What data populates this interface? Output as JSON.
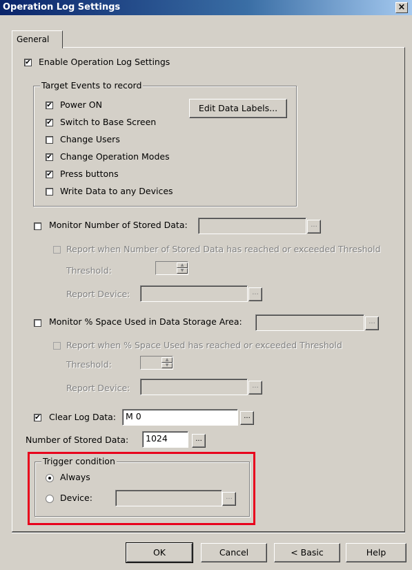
{
  "window": {
    "title": "Operation Log Settings",
    "close_glyph": "×"
  },
  "tabs": [
    {
      "label": "General"
    }
  ],
  "enable": {
    "label": "Enable Operation Log Settings",
    "checked": true
  },
  "target_events": {
    "title": "Target Events to record",
    "items": [
      {
        "label": "Power ON",
        "checked": true
      },
      {
        "label": "Switch to Base Screen",
        "checked": true
      },
      {
        "label": "Change Users",
        "checked": false
      },
      {
        "label": "Change Operation Modes",
        "checked": true
      },
      {
        "label": "Press buttons",
        "checked": true
      },
      {
        "label": "Write Data to any Devices",
        "checked": false
      }
    ],
    "edit_button": "Edit Data Labels..."
  },
  "monitor_stored": {
    "label": "Monitor Number of Stored Data:",
    "value": "",
    "report_label": "Report when Number of Stored Data has reached or exceeded Threshold",
    "threshold_label": "Threshold:",
    "report_device_label": "Report Device:"
  },
  "monitor_space": {
    "label": "Monitor % Space Used in Data Storage Area:",
    "value": "",
    "report_label": "Report when % Space Used has reached or exceeded Threshold",
    "threshold_label": "Threshold:",
    "report_device_label": "Report Device:"
  },
  "clear_log": {
    "label": "Clear Log Data:",
    "value": "M 0",
    "checked": true
  },
  "stored_count": {
    "label": "Number of Stored Data:",
    "value": "1024"
  },
  "trigger": {
    "title": "Trigger condition",
    "always_label": "Always",
    "device_label": "Device:",
    "selected": "always",
    "device_value": ""
  },
  "browse_label": "...",
  "check_glyph": "✔",
  "footer": {
    "ok": "OK",
    "cancel": "Cancel",
    "basic": "< Basic",
    "help": "Help"
  },
  "colors": {
    "title_bar": "#0a246a",
    "highlight_box": "#e8001c",
    "dialog_bg": "#d4d0c8"
  }
}
